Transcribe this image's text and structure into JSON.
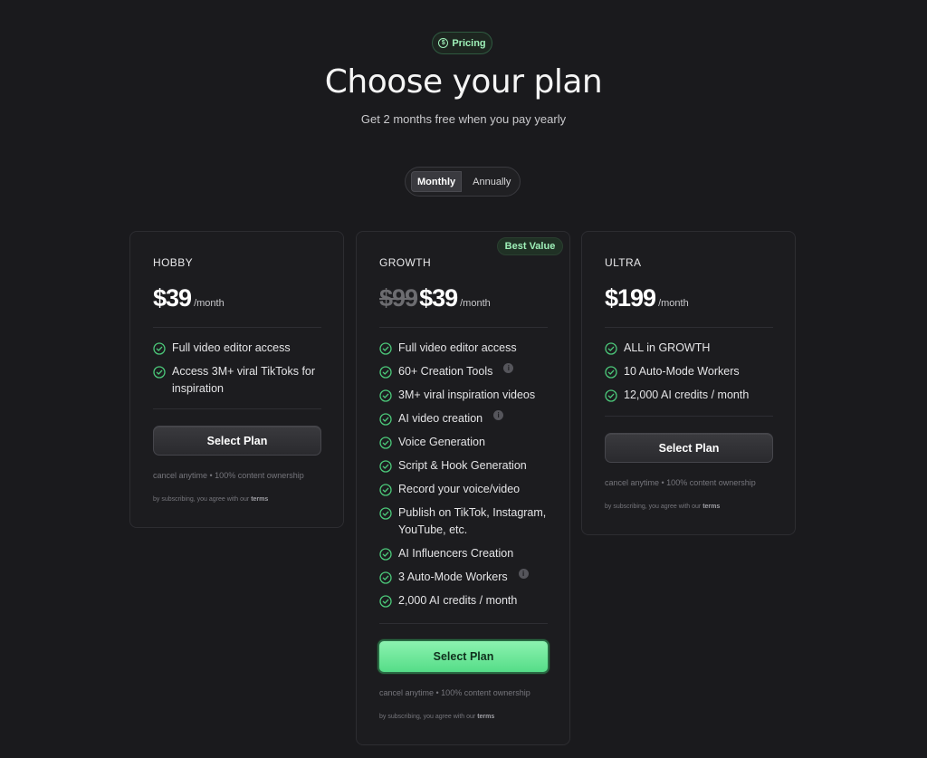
{
  "header": {
    "pill_label": "Pricing",
    "title": "Choose your plan",
    "subtitle": "Get 2 months free when you pay yearly"
  },
  "billing_toggle": {
    "options": [
      "Monthly",
      "Annually"
    ],
    "selected": "Monthly"
  },
  "plans": [
    {
      "name": "HOBBY",
      "price": "$39",
      "per": "/month",
      "features": [
        {
          "text": "Full video editor access",
          "info": false
        },
        {
          "text": "Access 3M+ viral TikToks for inspiration",
          "info": false
        }
      ],
      "button": "Select Plan",
      "note": "cancel anytime • 100% content ownership",
      "terms_prefix": "by subscribing, you agree with our",
      "terms_link": "terms"
    },
    {
      "name": "GROWTH",
      "badge": "Best Value",
      "old_price": "$99",
      "price": "$39",
      "per": "/month",
      "features": [
        {
          "text": "Full video editor access",
          "info": false
        },
        {
          "text": "60+ Creation Tools",
          "info": true
        },
        {
          "text": "3M+ viral inspiration videos",
          "info": false
        },
        {
          "text": "AI video creation",
          "info": true
        },
        {
          "text": "Voice Generation",
          "info": false
        },
        {
          "text": "Script & Hook Generation",
          "info": false
        },
        {
          "text": "Record your voice/video",
          "info": false
        },
        {
          "text": "Publish on TikTok, Instagram, YouTube, etc.",
          "info": false
        },
        {
          "text": "AI Influencers Creation",
          "info": false
        },
        {
          "text": "3 Auto-Mode Workers",
          "info": true
        },
        {
          "text": "2,000 AI credits / month",
          "info": false
        }
      ],
      "button": "Select Plan",
      "note": "cancel anytime • 100% content ownership",
      "terms_prefix": "by subscribing, you agree with our",
      "terms_link": "terms"
    },
    {
      "name": "ULTRA",
      "price": "$199",
      "per": "/month",
      "features": [
        {
          "text": "ALL in GROWTH",
          "info": false
        },
        {
          "text": "10 Auto-Mode Workers",
          "info": false
        },
        {
          "text": "12,000 AI credits / month",
          "info": false
        }
      ],
      "button": "Select Plan",
      "note": "cancel anytime • 100% content ownership",
      "terms_prefix": "by subscribing, you agree with our",
      "terms_link": "terms"
    }
  ],
  "icons": {
    "check": "check-circle-icon",
    "info": "info-icon",
    "pricing": "dollar-circle-icon"
  },
  "colors": {
    "background": "#1a1a1d",
    "accent_green": "#55dd88",
    "check_green": "#4cc97a"
  }
}
